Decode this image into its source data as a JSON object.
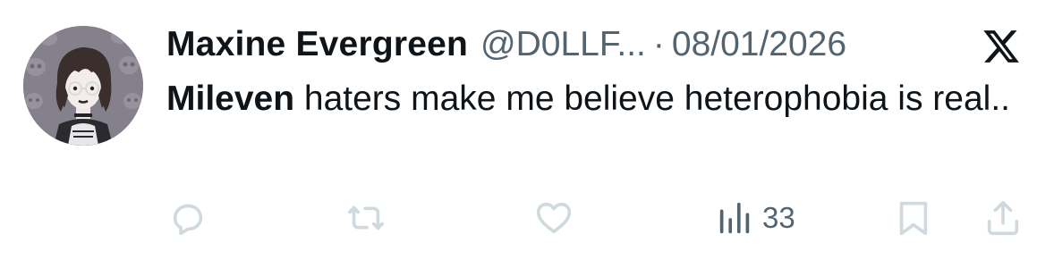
{
  "post": {
    "display_name": "Maxine Evergreen",
    "handle": "@D0LLF...",
    "separator": "·",
    "date": "08/01/2026",
    "text_mention": "Mileven",
    "text_body": " haters make me believe heterophobia is real.."
  },
  "actions": {
    "reply_icon": "reply-icon",
    "repost_icon": "repost-icon",
    "like_icon": "heart-icon",
    "views_icon": "views-chart-icon",
    "views_count": "33",
    "bookmark_icon": "bookmark-icon",
    "share_icon": "share-icon"
  },
  "colors": {
    "text_primary": "#0f1419",
    "text_secondary": "#536471",
    "icon_muted": "#cfd9de",
    "views_icon": "#536471"
  }
}
